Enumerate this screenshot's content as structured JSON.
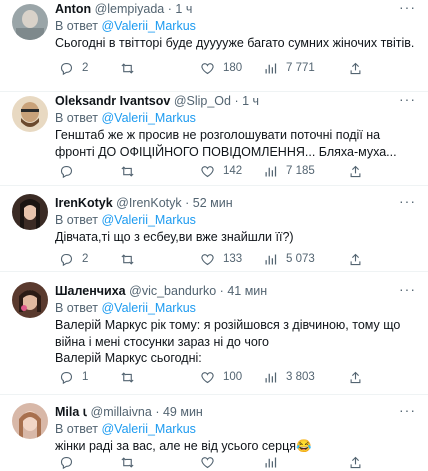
{
  "reply_prefix": "В ответ",
  "tweets": [
    {
      "name": "Anton",
      "handle": "@lempiyada",
      "time": "1 ч",
      "reply_to": "@Valerii_Markus",
      "text": "Сьогодні в твітторі буде дууууже багато сумних жіночих твітів.",
      "replies": "2",
      "retweets": "",
      "likes": "180",
      "views": "7 771",
      "avatar_color": "#9aa5a8"
    },
    {
      "name": "Oleksandr Ivantsov",
      "handle": "@Slip_Od",
      "time": "1 ч",
      "reply_to": "@Valerii_Markus",
      "text": "Генштаб же ж просив не розголошувати поточні події на фронті ДО ОФІЦІЙНОГО ПОВІДОМЛЕННЯ... Бляха-муха...",
      "replies": "",
      "retweets": "",
      "likes": "142",
      "views": "7 185",
      "avatar_color": "#c9a27a"
    },
    {
      "name": "IrenKotyk",
      "handle": "@IrenKotyk",
      "time": "52 мин",
      "reply_to": "@Valerii_Markus",
      "text": "Дівчата,ті що з есбеу,ви вже знайшли її?)",
      "replies": "2",
      "retweets": "",
      "likes": "133",
      "views": "5 073",
      "avatar_color": "#3b2b25"
    },
    {
      "name": "Шаленчиха",
      "handle": "@vic_bandurko",
      "time": "41 мин",
      "reply_to": "@Valerii_Markus",
      "text": "Валерій Маркус рік тому: я розійшовся з дівчиною, тому що війна і мені стосунки зараз ні до чого\nВалерій Маркус сьогодні:",
      "replies": "1",
      "retweets": "",
      "likes": "100",
      "views": "3 803",
      "avatar_color": "#5a3a2e"
    },
    {
      "name": "Mila ꙇ",
      "handle": "@millaivna",
      "time": "49 мин",
      "reply_to": "@Valerii_Markus",
      "text": "жінки раді за вас, але не від усього серця😂",
      "replies": "",
      "retweets": "",
      "likes": "",
      "views": "",
      "avatar_color": "#d8b8a8"
    }
  ]
}
